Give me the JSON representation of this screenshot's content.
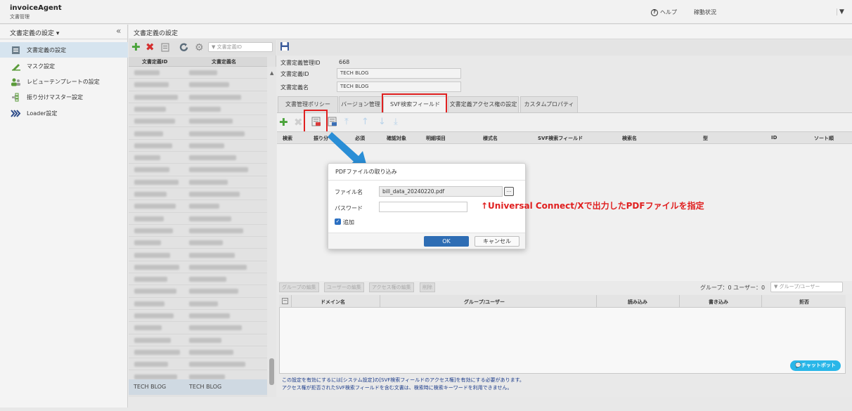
{
  "header": {
    "brand": "invoiceAgent",
    "brand_sub": "文書管理",
    "help": "ヘルプ",
    "status": "稼動状況"
  },
  "sidebar": {
    "title": "文書定義の設定 ▾",
    "items": [
      {
        "label": "文書定義の設定",
        "icon": "document-icon"
      },
      {
        "label": "マスク設定",
        "icon": "pen-icon"
      },
      {
        "label": "レビューテンプレートの設定",
        "icon": "users-icon"
      },
      {
        "label": "振り分けマスター設定",
        "icon": "flow-icon"
      },
      {
        "label": "Loader設定",
        "icon": "chevrons-icon"
      }
    ]
  },
  "breadcrumb": "文書定義の設定",
  "list": {
    "filter_placeholder": "文書定義ID",
    "col_id": "文書定義ID",
    "col_name": "文書定義名",
    "last_row_id": "TECH BLOG",
    "last_row_name": "TECH BLOG"
  },
  "detail": {
    "mgmt_id_label": "文書定義管理ID",
    "mgmt_id_value": "668",
    "id_label": "文書定義ID",
    "id_value": "TECH BLOG",
    "name_label": "文書定義名",
    "name_value": "TECH BLOG"
  },
  "tabs": [
    "文書管理ポリシー",
    "バージョン管理",
    "SVF検索フィールド",
    "文書定義アクセス権の設定",
    "カスタムプロパティ"
  ],
  "grid_columns": [
    "検索",
    "振り分",
    "必須",
    "確認対象",
    "明細項目",
    "様式名",
    "SVF検索フィールド",
    "検索名",
    "型",
    "ID",
    "ソート順"
  ],
  "group": {
    "buttons": [
      "グループの編集",
      "ユーザーの編集",
      "アクセス権の編集",
      "削除"
    ],
    "count": "グループ：0  ユーザー：0",
    "filter_placeholder": "グループ/ユーザー",
    "columns": [
      "ドメイン名",
      "グループ/ユーザー",
      "読み込み",
      "書き込み",
      "拒否"
    ]
  },
  "notes": {
    "line1": "この設定を有効にするには[システム設定]の[SVF検索フィールドのアクセス権]を有効にする必要があります。",
    "line2": "アクセス権が拒否されたSVF検索フィールドを含む文書は、検索時に検索キーワードを利用できません。"
  },
  "chatbot": "チャットボット",
  "dialog": {
    "title": "PDFファイルの取り込み",
    "file_label": "ファイル名",
    "file_value": "bill_data_20240220.pdf",
    "browse": "...",
    "password_label": "パスワード",
    "add_label": "追加",
    "ok": "OK",
    "cancel": "キャンセル"
  },
  "annotation": "↑Universal Connect/Xで出力したPDFファイルを指定",
  "colors": {
    "accent": "#2e6db4",
    "highlight": "#e02020",
    "arrow": "#2a8ed6"
  }
}
